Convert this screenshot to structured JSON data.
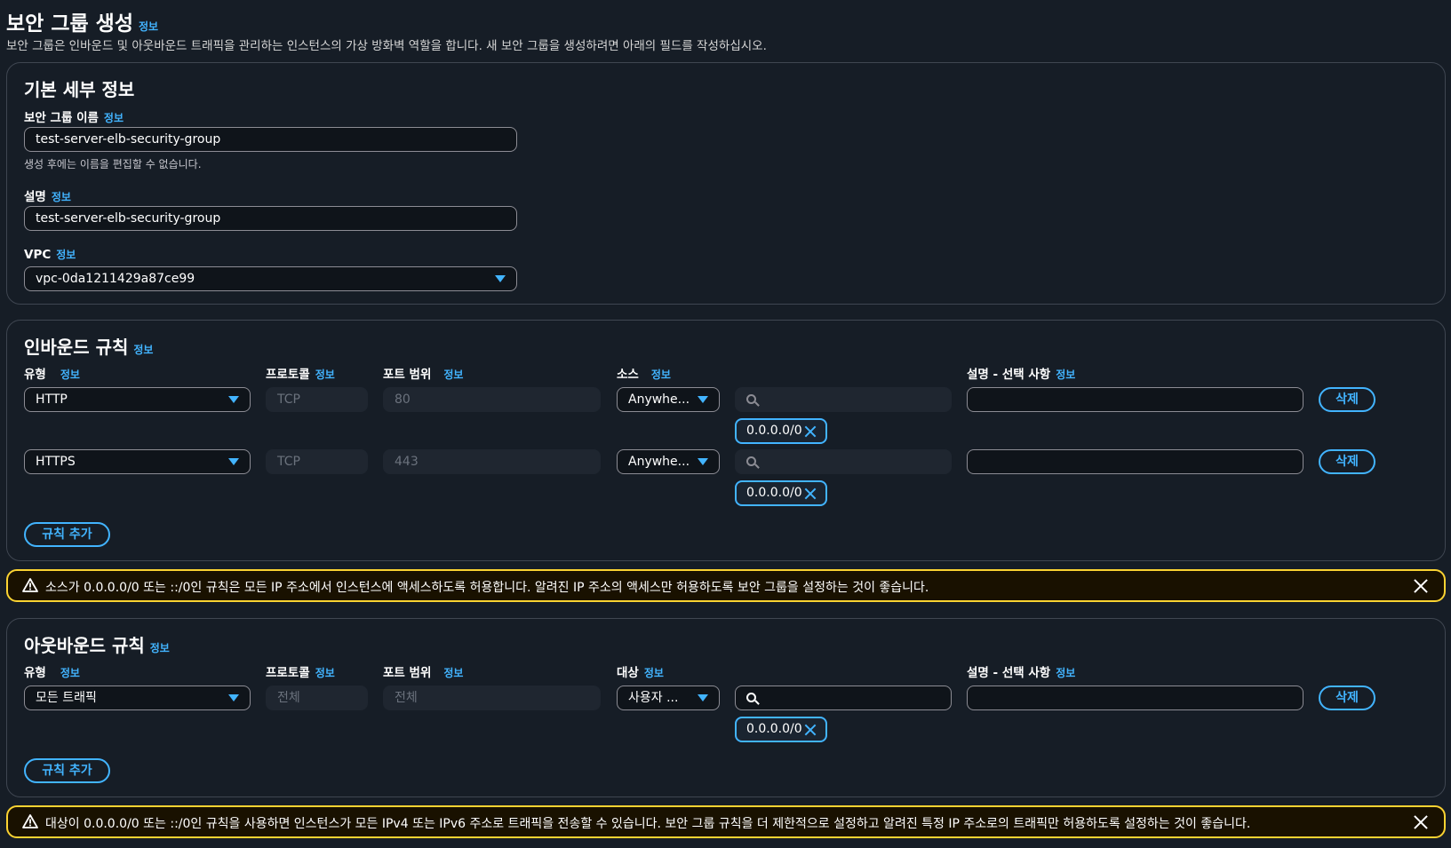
{
  "page": {
    "title": "보안 그룹 생성",
    "info": "정보",
    "description": "보안 그룹은 인바운드 및 아웃바운드 트래픽을 관리하는 인스턴스의 가상 방화벽 역할을 합니다. 새 보안 그룹을 생성하려면 아래의 필드를 작성하십시오."
  },
  "basic": {
    "title": "기본 세부 정보",
    "name_label": "보안 그룹 이름",
    "name_value": "test-server-elb-security-group",
    "name_hint": "생성 후에는 이름을 편집할 수 없습니다.",
    "desc_label": "설명",
    "desc_value": "test-server-elb-security-group",
    "vpc_label": "VPC",
    "vpc_value": "vpc-0da1211429a87ce99"
  },
  "inbound": {
    "title": "인바운드 규칙",
    "col_type": "유형",
    "col_protocol": "프로토콜",
    "col_port": "포트 범위",
    "col_source": "소스",
    "col_desc": "설명 - 선택 사항",
    "rules": [
      {
        "type": "HTTP",
        "protocol": "TCP",
        "port": "80",
        "source": "Anywhe...",
        "cidr": "0.0.0.0/0",
        "delete": "삭제"
      },
      {
        "type": "HTTPS",
        "protocol": "TCP",
        "port": "443",
        "source": "Anywhe...",
        "cidr": "0.0.0.0/0",
        "delete": "삭제"
      }
    ],
    "add_rule": "규칙 추가"
  },
  "inbound_alert": {
    "message": "소스가 0.0.0.0/0 또는 ::/0인 규칙은 모든 IP 주소에서 인스턴스에 액세스하도록 허용합니다. 알려진 IP 주소의 액세스만 허용하도록 보안 그룹을 설정하는 것이 좋습니다."
  },
  "outbound": {
    "title": "아웃바운드 규칙",
    "col_type": "유형",
    "col_protocol": "프로토콜",
    "col_port": "포트 범위",
    "col_dest": "대상",
    "col_desc": "설명 - 선택 사항",
    "rules": [
      {
        "type": "모든 트래픽",
        "protocol": "전체",
        "port": "전체",
        "dest": "사용자 ...",
        "cidr": "0.0.0.0/0",
        "delete": "삭제"
      }
    ],
    "add_rule": "규칙 추가"
  },
  "outbound_alert": {
    "message": "대상이 0.0.0.0/0 또는 ::/0인 규칙을 사용하면 인스턴스가 모든 IPv4 또는 IPv6 주소로 트래픽을 전송할 수 있습니다. 보안 그룹 규칙을 더 제한적으로 설정하고 알려진 특정 IP 주소로의 트래픽만 허용하도록 설정하는 것이 좋습니다."
  },
  "colors": {
    "background": "#161d26",
    "accent": "#42b4ff",
    "warning_border": "#fbd332",
    "panel_border": "#3f4651"
  }
}
